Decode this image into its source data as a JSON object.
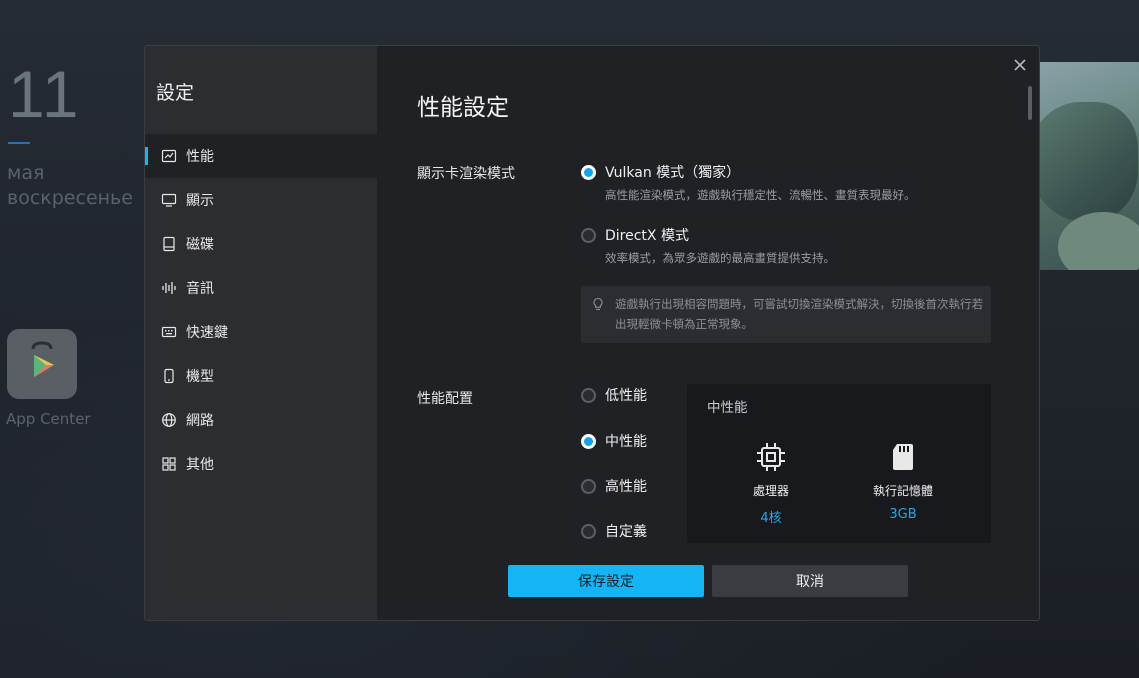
{
  "desktop": {
    "clock": "11",
    "date_month": "мая",
    "date_day": "воскресенье",
    "app_label": "App Center"
  },
  "dialog": {
    "sidebar_title": "設定",
    "nav": [
      {
        "label": "性能",
        "icon": "performance-chart-icon",
        "active": true
      },
      {
        "label": "顯示",
        "icon": "monitor-icon"
      },
      {
        "label": "磁碟",
        "icon": "disk-icon"
      },
      {
        "label": "音訊",
        "icon": "audio-wave-icon"
      },
      {
        "label": "快速鍵",
        "icon": "keyboard-icon"
      },
      {
        "label": "機型",
        "icon": "phone-icon"
      },
      {
        "label": "網路",
        "icon": "globe-icon"
      },
      {
        "label": "其他",
        "icon": "grid-icon"
      }
    ],
    "page_title": "性能設定",
    "render_mode": {
      "label": "顯示卡渲染模式",
      "options": [
        {
          "label": "Vulkan 模式（獨家）",
          "desc": "高性能渲染模式，遊戲執行穩定性、流暢性、畫質表現最好。",
          "checked": true
        },
        {
          "label": "DirectX 模式",
          "desc": "效率模式，為眾多遊戲的最高畫質提供支持。",
          "checked": false
        }
      ],
      "hint": "遊戲執行出現相容問題時，可嘗試切換渲染模式解決，切換後首次執行若出現輕微卡頓為正常現象。"
    },
    "perf_config": {
      "label": "性能配置",
      "options": [
        {
          "label": "低性能",
          "checked": false
        },
        {
          "label": "中性能",
          "checked": true
        },
        {
          "label": "高性能",
          "checked": false
        },
        {
          "label": "自定義",
          "checked": false
        }
      ],
      "card": {
        "title": "中性能",
        "cpu_name": "處理器",
        "cpu_value": "4核",
        "ram_name": "執行記憶體",
        "ram_value": "3GB"
      }
    },
    "buttons": {
      "save": "保存設定",
      "cancel": "取消"
    },
    "accent_color": "#14b4f5"
  }
}
